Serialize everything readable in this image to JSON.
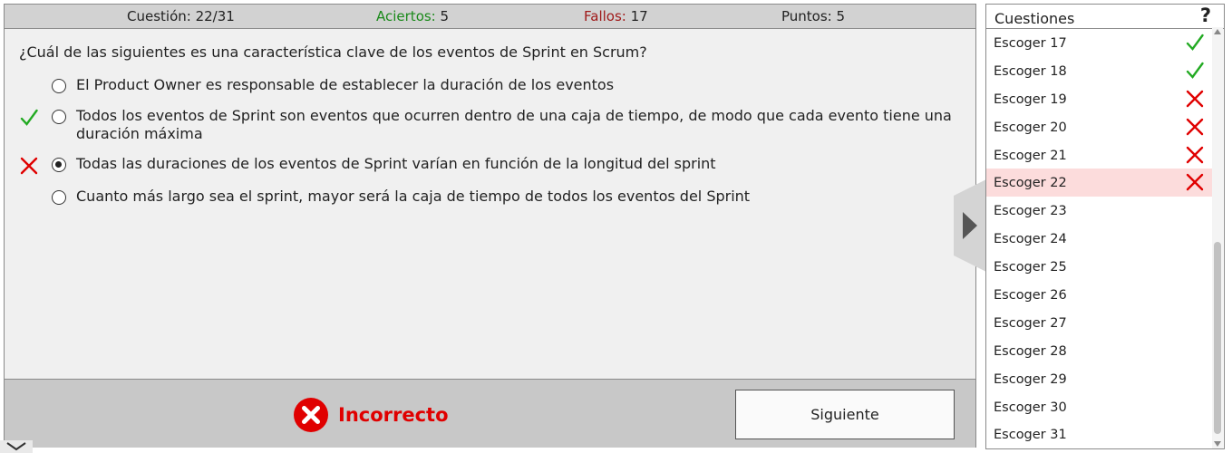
{
  "status": {
    "question_label": "Cuestión:",
    "question_value": "22/31",
    "hits_label": "Aciertos:",
    "hits_value": "5",
    "misses_label": "Fallos:",
    "misses_value": "17",
    "points_label": "Puntos:",
    "points_value": "5"
  },
  "question": {
    "text": "¿Cuál de las siguientes es una característica clave de los eventos de Sprint en Scrum?",
    "options": [
      {
        "text": "El Product Owner es responsable de establecer la duración de los eventos",
        "mark": "",
        "selected": false
      },
      {
        "text": "Todos los eventos de Sprint son eventos que ocurren dentro de una caja de tiempo, de modo que cada evento tiene una duración máxima",
        "mark": "check-icon",
        "selected": false
      },
      {
        "text": "Todas las duraciones de los eventos de Sprint varían en función de la longitud del sprint",
        "mark": "cross-icon",
        "selected": true
      },
      {
        "text": "Cuanto más largo sea el sprint, mayor será la caja de tiempo de todos los eventos del Sprint",
        "mark": "",
        "selected": false
      }
    ]
  },
  "result": {
    "label": "Incorrecto",
    "icon": "error-circle-icon",
    "color": "#e00000"
  },
  "next_button": {
    "label": "Siguiente"
  },
  "sidebar": {
    "title": "Cuestiones",
    "help": "?",
    "items": [
      {
        "label": "Escoger 17",
        "status": "check-icon"
      },
      {
        "label": "Escoger 18",
        "status": "check-icon"
      },
      {
        "label": "Escoger 19",
        "status": "cross-icon"
      },
      {
        "label": "Escoger 20",
        "status": "cross-icon"
      },
      {
        "label": "Escoger 21",
        "status": "cross-icon"
      },
      {
        "label": "Escoger 22",
        "status": "cross-icon",
        "current": true
      },
      {
        "label": "Escoger 23",
        "status": ""
      },
      {
        "label": "Escoger 24",
        "status": ""
      },
      {
        "label": "Escoger 25",
        "status": ""
      },
      {
        "label": "Escoger 26",
        "status": ""
      },
      {
        "label": "Escoger 27",
        "status": ""
      },
      {
        "label": "Escoger 28",
        "status": ""
      },
      {
        "label": "Escoger 29",
        "status": ""
      },
      {
        "label": "Escoger 30",
        "status": ""
      },
      {
        "label": "Escoger 31",
        "status": ""
      }
    ]
  },
  "colors": {
    "correct": "#22aa22",
    "wrong": "#e00000",
    "current_row": "#fcdcdc"
  }
}
